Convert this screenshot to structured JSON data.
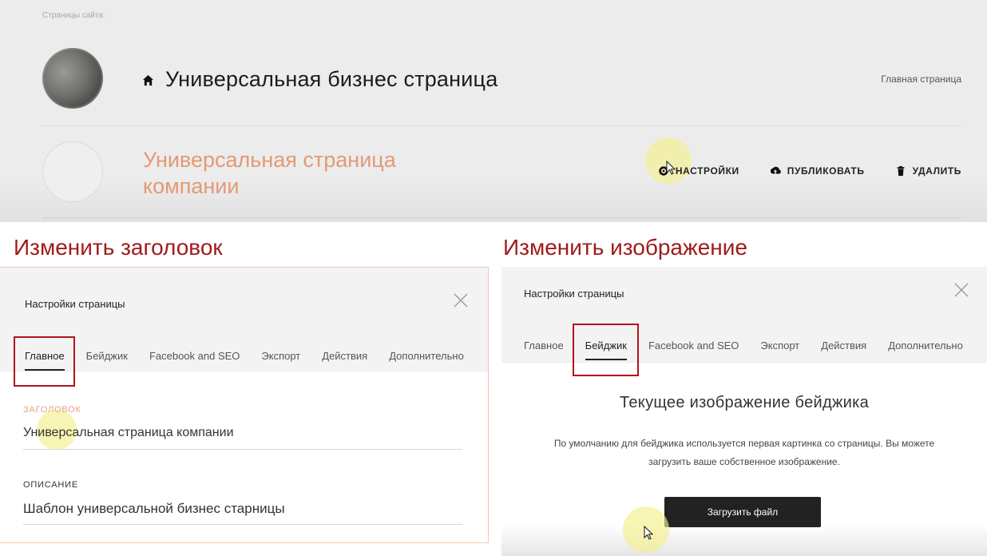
{
  "site": {
    "section_label": "Страницы сайта:",
    "pages": [
      {
        "title": "Универсальная бизнес страница",
        "badge": "Главная страница",
        "icon": "home-icon"
      },
      {
        "title": "Универсальная страница компании"
      }
    ],
    "actions": [
      {
        "label": "НАСТРОЙКИ",
        "icon": "gear-icon"
      },
      {
        "label": "ПУБЛИКОВАТЬ",
        "icon": "upload-icon"
      },
      {
        "label": "УДАЛИТЬ",
        "icon": "trash-icon"
      }
    ]
  },
  "captions": {
    "left": "Изменить заголовок",
    "right": "Изменить изображение"
  },
  "settings_left": {
    "title": "Настройки страницы",
    "tabs": [
      "Главное",
      "Бейджик",
      "Facebook and SEO",
      "Экспорт",
      "Действия",
      "Дополнительно"
    ],
    "active_tab": "Главное",
    "fields": [
      {
        "label": "ЗАГОЛОВОК",
        "value": "Универсальная страница компании"
      },
      {
        "label": "ОПИСАНИЕ",
        "value": "Шаблон универсальной бизнес старницы"
      }
    ]
  },
  "settings_right": {
    "title": "Настройки страницы",
    "tabs": [
      "Главное",
      "Бейджик",
      "Facebook and SEO",
      "Экспорт",
      "Действия",
      "Дополнительно"
    ],
    "active_tab": "Бейджик",
    "heading": "Текущее изображение бейджика",
    "description": "По умолчанию для бейджика используется первая картинка со страницы. Вы можете загрузить ваше собственное изображение.",
    "upload_label": "Загрузить файл"
  },
  "colors": {
    "accent_title": "#e39a74",
    "caption_red": "#a11a1a",
    "highlight_box": "#b3121b",
    "button_dark": "#222222",
    "field_label_orange": "#e8a17c"
  }
}
